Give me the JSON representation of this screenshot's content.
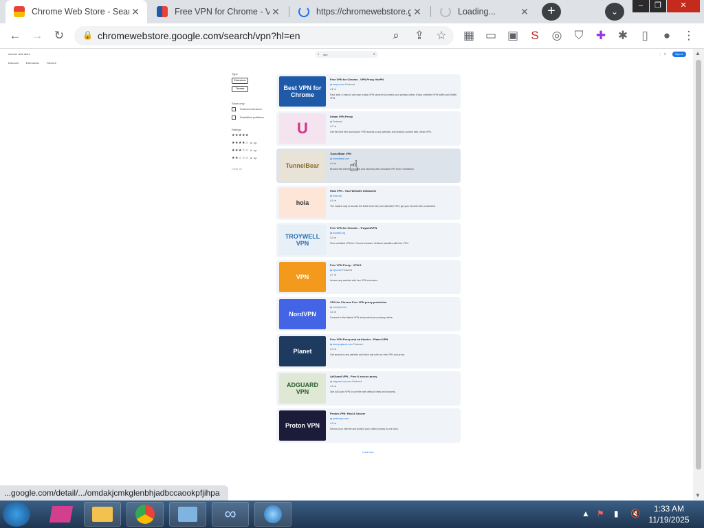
{
  "tabs": [
    {
      "title": "Chrome Web Store - Search",
      "active": true
    },
    {
      "title": "Free VPN for Chrome - VPN",
      "active": false
    },
    {
      "title": "https://chromewebstore.goo",
      "active": false
    },
    {
      "title": "Loading...",
      "active": false
    }
  ],
  "toolbar": {
    "url": "chromewebstore.google.com/search/vpn?hl=en"
  },
  "page": {
    "store_title": "chrome web store",
    "nav": [
      "Discover",
      "Extensions",
      "Themes"
    ],
    "search_value": "vpn",
    "signin_label": "Sign in",
    "filters": {
      "type_heading": "Type",
      "type_chips": [
        "Extensions",
        "Themes"
      ],
      "show_heading": "Show only",
      "show_options": [
        "Featured extensions",
        "Established publishers"
      ],
      "ratings_heading": "Ratings",
      "ratings": [
        {
          "stars": "★★★★★",
          "label": ""
        },
        {
          "stars": "★★★★☆",
          "label": "& up"
        },
        {
          "stars": "★★★☆☆",
          "label": "& up"
        },
        {
          "stars": "★★☆☆☆",
          "label": "& up"
        }
      ],
      "clear_label": "Clear all"
    },
    "results": [
      {
        "title": "Free VPN for Chrome - VPN Proxy VeePN",
        "publisher": "veepn.com",
        "badge": "Featured",
        "rating": "4.5 ★",
        "desc": "Fast, safe & easy to use way to stay VPN secured to protect your privacy online. Enjoy unlimited VPN traffic and Netflix VPN.",
        "thumb_text": "Best VPN for Chrome",
        "thumb_bg": "#1e5aa8",
        "thumb_fg": "#ffffff"
      },
      {
        "title": "Urban VPN Proxy",
        "publisher": "",
        "badge": "Featured",
        "rating": "4.7 ★",
        "desc": "Get the best free and secure VPN access to any website, and unblock content with Urban VPN.",
        "thumb_text": "U",
        "thumb_bg": "#f3e4f0",
        "thumb_fg": "#d63384"
      },
      {
        "title": "TunnelBear VPN",
        "publisher": "tunnelbear.com",
        "badge": "",
        "rating": "4.4 ★",
        "desc": "Browse the internet privately and securely with a trusted VPN from TunnelBear.",
        "thumb_text": "TunnelBear",
        "thumb_bg": "#e8e3d6",
        "thumb_fg": "#8a6a2a"
      },
      {
        "title": "Hola VPN - Your Website Unblocker",
        "publisher": "hola.org",
        "badge": "",
        "rating": "4.0 ★",
        "desc": "The easiest way to access the Earth best free and unlimited VPN, get your favorite sites unblocked.",
        "thumb_text": "hola",
        "thumb_bg": "#fde6d8",
        "thumb_fg": "#333333"
      },
      {
        "title": "Free VPN for Chrome - TroywellVPN",
        "publisher": "troywell.org",
        "badge": "",
        "rating": "3.4 ★",
        "desc": "Free unlimited VPN for Chrome browser. Unblock websites with free VPN.",
        "thumb_text": "TROYWELL VPN",
        "thumb_bg": "#e7f0f7",
        "thumb_fg": "#2a6db0"
      },
      {
        "title": "Free VPN Proxy - VPN.S",
        "publisher": "vpn.com",
        "badge": "Featured",
        "rating": "4.7 ★",
        "desc": "Access any website with free VPN extension.",
        "thumb_text": "VPN",
        "thumb_bg": "#f39a1c",
        "thumb_fg": "#ffffff"
      },
      {
        "title": "VPN for Chrome Free VPN proxy protection",
        "publisher": "nordvpn.com",
        "badge": "",
        "rating": "4.3 ★",
        "desc": "Connect to the fastest VPN and protect your privacy online.",
        "thumb_text": "NordVPN",
        "thumb_bg": "#4264e5",
        "thumb_fg": "#ffffff"
      },
      {
        "title": "Free VPN Proxy and ad blocker - Planet VPN",
        "publisher": "freevpnplanet.com",
        "badge": "Featured",
        "rating": "4.4 ★",
        "desc": "Get access to any website and block ads with our free VPN and proxy.",
        "thumb_text": "Planet",
        "thumb_bg": "#1f3a5f",
        "thumb_fg": "#ffffff"
      },
      {
        "title": "AdGuard VPN - Free & secure proxy",
        "publisher": "adguard-vpn.com",
        "badge": "Featured",
        "rating": "4.3 ★",
        "desc": "Use AdGuard VPN to surf the web without limits and securely.",
        "thumb_text": "ADGUARD VPN",
        "thumb_bg": "#dfe8d4",
        "thumb_fg": "#2c5e2e"
      },
      {
        "title": "Proton VPN: Fast & Secure",
        "publisher": "protonvpn.com",
        "badge": "",
        "rating": "4.3 ★",
        "desc": "Secure your internet and protect your online privacy to one click.",
        "thumb_text": "Proton VPN",
        "thumb_bg": "#1c1b3a",
        "thumb_fg": "#ffffff"
      }
    ],
    "load_more": "Load more"
  },
  "status_url": "...google.com/detail/.../omdakjcmkglenbhjadbccaookpfjihpa",
  "taskbar": {
    "time": "1:33 AM",
    "date": "11/19/2025"
  },
  "colors": {
    "accent": "#1a73e8",
    "tabbar": "#dee1e6",
    "taskbar": "#1f3550"
  }
}
